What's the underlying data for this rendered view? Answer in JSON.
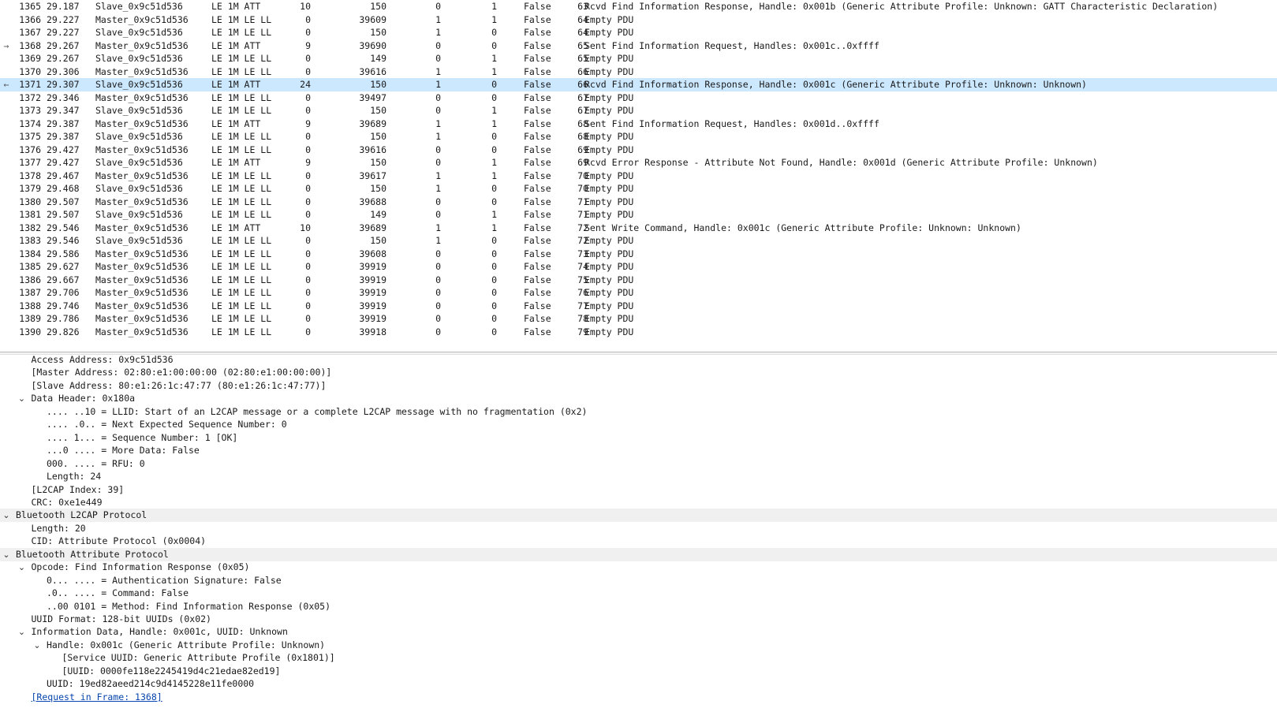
{
  "packets": [
    {
      "no": "1365",
      "time": "29.187",
      "src": "Slave_0x9c51d536",
      "proto": "LE 1M ATT",
      "len": "10",
      "ch": "150",
      "sn": "0",
      "nesn": "1",
      "md": "False",
      "idx": "63",
      "info": "Rcvd Find Information Response, Handle: 0x001b (Generic Attribute Profile: Unknown: GATT Characteristic Declaration)",
      "arrow": ""
    },
    {
      "no": "1366",
      "time": "29.227",
      "src": "Master_0x9c51d536",
      "proto": "LE 1M LE LL",
      "len": "0",
      "ch": "39609",
      "sn": "1",
      "nesn": "1",
      "md": "False",
      "idx": "64",
      "info": "Empty PDU",
      "arrow": ""
    },
    {
      "no": "1367",
      "time": "29.227",
      "src": "Slave_0x9c51d536",
      "proto": "LE 1M LE LL",
      "len": "0",
      "ch": "150",
      "sn": "1",
      "nesn": "0",
      "md": "False",
      "idx": "64",
      "info": "Empty PDU",
      "arrow": ""
    },
    {
      "no": "1368",
      "time": "29.267",
      "src": "Master_0x9c51d536",
      "proto": "LE 1M ATT",
      "len": "9",
      "ch": "39690",
      "sn": "0",
      "nesn": "0",
      "md": "False",
      "idx": "65",
      "info": "Sent Find Information Request, Handles: 0x001c..0xffff",
      "arrow": "→"
    },
    {
      "no": "1369",
      "time": "29.267",
      "src": "Slave_0x9c51d536",
      "proto": "LE 1M LE LL",
      "len": "0",
      "ch": "149",
      "sn": "0",
      "nesn": "1",
      "md": "False",
      "idx": "65",
      "info": "Empty PDU",
      "arrow": ""
    },
    {
      "no": "1370",
      "time": "29.306",
      "src": "Master_0x9c51d536",
      "proto": "LE 1M LE LL",
      "len": "0",
      "ch": "39616",
      "sn": "1",
      "nesn": "1",
      "md": "False",
      "idx": "66",
      "info": "Empty PDU",
      "arrow": ""
    },
    {
      "no": "1371",
      "time": "29.307",
      "src": "Slave_0x9c51d536",
      "proto": "LE 1M ATT",
      "len": "24",
      "ch": "150",
      "sn": "1",
      "nesn": "0",
      "md": "False",
      "idx": "66",
      "info": "Rcvd Find Information Response, Handle: 0x001c (Generic Attribute Profile: Unknown: Unknown)",
      "arrow": "←",
      "selected": true
    },
    {
      "no": "1372",
      "time": "29.346",
      "src": "Master_0x9c51d536",
      "proto": "LE 1M LE LL",
      "len": "0",
      "ch": "39497",
      "sn": "0",
      "nesn": "0",
      "md": "False",
      "idx": "67",
      "info": "Empty PDU",
      "arrow": ""
    },
    {
      "no": "1373",
      "time": "29.347",
      "src": "Slave_0x9c51d536",
      "proto": "LE 1M LE LL",
      "len": "0",
      "ch": "150",
      "sn": "0",
      "nesn": "1",
      "md": "False",
      "idx": "67",
      "info": "Empty PDU",
      "arrow": ""
    },
    {
      "no": "1374",
      "time": "29.387",
      "src": "Master_0x9c51d536",
      "proto": "LE 1M ATT",
      "len": "9",
      "ch": "39689",
      "sn": "1",
      "nesn": "1",
      "md": "False",
      "idx": "68",
      "info": "Sent Find Information Request, Handles: 0x001d..0xffff",
      "arrow": ""
    },
    {
      "no": "1375",
      "time": "29.387",
      "src": "Slave_0x9c51d536",
      "proto": "LE 1M LE LL",
      "len": "0",
      "ch": "150",
      "sn": "1",
      "nesn": "0",
      "md": "False",
      "idx": "68",
      "info": "Empty PDU",
      "arrow": ""
    },
    {
      "no": "1376",
      "time": "29.427",
      "src": "Master_0x9c51d536",
      "proto": "LE 1M LE LL",
      "len": "0",
      "ch": "39616",
      "sn": "0",
      "nesn": "0",
      "md": "False",
      "idx": "69",
      "info": "Empty PDU",
      "arrow": ""
    },
    {
      "no": "1377",
      "time": "29.427",
      "src": "Slave_0x9c51d536",
      "proto": "LE 1M ATT",
      "len": "9",
      "ch": "150",
      "sn": "0",
      "nesn": "1",
      "md": "False",
      "idx": "69",
      "info": "Rcvd Error Response - Attribute Not Found, Handle: 0x001d (Generic Attribute Profile: Unknown)",
      "arrow": ""
    },
    {
      "no": "1378",
      "time": "29.467",
      "src": "Master_0x9c51d536",
      "proto": "LE 1M LE LL",
      "len": "0",
      "ch": "39617",
      "sn": "1",
      "nesn": "1",
      "md": "False",
      "idx": "70",
      "info": "Empty PDU",
      "arrow": ""
    },
    {
      "no": "1379",
      "time": "29.468",
      "src": "Slave_0x9c51d536",
      "proto": "LE 1M LE LL",
      "len": "0",
      "ch": "150",
      "sn": "1",
      "nesn": "0",
      "md": "False",
      "idx": "70",
      "info": "Empty PDU",
      "arrow": ""
    },
    {
      "no": "1380",
      "time": "29.507",
      "src": "Master_0x9c51d536",
      "proto": "LE 1M LE LL",
      "len": "0",
      "ch": "39688",
      "sn": "0",
      "nesn": "0",
      "md": "False",
      "idx": "71",
      "info": "Empty PDU",
      "arrow": ""
    },
    {
      "no": "1381",
      "time": "29.507",
      "src": "Slave_0x9c51d536",
      "proto": "LE 1M LE LL",
      "len": "0",
      "ch": "149",
      "sn": "0",
      "nesn": "1",
      "md": "False",
      "idx": "71",
      "info": "Empty PDU",
      "arrow": ""
    },
    {
      "no": "1382",
      "time": "29.546",
      "src": "Master_0x9c51d536",
      "proto": "LE 1M ATT",
      "len": "10",
      "ch": "39689",
      "sn": "1",
      "nesn": "1",
      "md": "False",
      "idx": "72",
      "info": "Sent Write Command, Handle: 0x001c (Generic Attribute Profile: Unknown: Unknown)",
      "arrow": ""
    },
    {
      "no": "1383",
      "time": "29.546",
      "src": "Slave_0x9c51d536",
      "proto": "LE 1M LE LL",
      "len": "0",
      "ch": "150",
      "sn": "1",
      "nesn": "0",
      "md": "False",
      "idx": "72",
      "info": "Empty PDU",
      "arrow": ""
    },
    {
      "no": "1384",
      "time": "29.586",
      "src": "Master_0x9c51d536",
      "proto": "LE 1M LE LL",
      "len": "0",
      "ch": "39608",
      "sn": "0",
      "nesn": "0",
      "md": "False",
      "idx": "73",
      "info": "Empty PDU",
      "arrow": ""
    },
    {
      "no": "1385",
      "time": "29.627",
      "src": "Master_0x9c51d536",
      "proto": "LE 1M LE LL",
      "len": "0",
      "ch": "39919",
      "sn": "0",
      "nesn": "0",
      "md": "False",
      "idx": "74",
      "info": "Empty PDU",
      "arrow": ""
    },
    {
      "no": "1386",
      "time": "29.667",
      "src": "Master_0x9c51d536",
      "proto": "LE 1M LE LL",
      "len": "0",
      "ch": "39919",
      "sn": "0",
      "nesn": "0",
      "md": "False",
      "idx": "75",
      "info": "Empty PDU",
      "arrow": ""
    },
    {
      "no": "1387",
      "time": "29.706",
      "src": "Master_0x9c51d536",
      "proto": "LE 1M LE LL",
      "len": "0",
      "ch": "39919",
      "sn": "0",
      "nesn": "0",
      "md": "False",
      "idx": "76",
      "info": "Empty PDU",
      "arrow": ""
    },
    {
      "no": "1388",
      "time": "29.746",
      "src": "Master_0x9c51d536",
      "proto": "LE 1M LE LL",
      "len": "0",
      "ch": "39919",
      "sn": "0",
      "nesn": "0",
      "md": "False",
      "idx": "77",
      "info": "Empty PDU",
      "arrow": ""
    },
    {
      "no": "1389",
      "time": "29.786",
      "src": "Master_0x9c51d536",
      "proto": "LE 1M LE LL",
      "len": "0",
      "ch": "39919",
      "sn": "0",
      "nesn": "0",
      "md": "False",
      "idx": "78",
      "info": "Empty PDU",
      "arrow": ""
    },
    {
      "no": "1390",
      "time": "29.826",
      "src": "Master_0x9c51d536",
      "proto": "LE 1M LE LL",
      "len": "0",
      "ch": "39918",
      "sn": "0",
      "nesn": "0",
      "md": "False",
      "idx": "79",
      "info": "Empty PDU",
      "arrow": ""
    }
  ],
  "details": [
    {
      "text": "Access Address: 0x9c51d536",
      "level": 2,
      "expander": "none"
    },
    {
      "text": "[Master Address: 02:80:e1:00:00:00 (02:80:e1:00:00:00)]",
      "level": 2,
      "expander": "none"
    },
    {
      "text": "[Slave Address: 80:e1:26:1c:47:77 (80:e1:26:1c:47:77)]",
      "level": 2,
      "expander": "none"
    },
    {
      "text": "Data Header: 0x180a",
      "level": 2,
      "expander": "expanded"
    },
    {
      "text": ".... ..10 = LLID: Start of an L2CAP message or a complete L2CAP message with no fragmentation (0x2)",
      "level": 3,
      "expander": "none"
    },
    {
      "text": ".... .0.. = Next Expected Sequence Number: 0",
      "level": 3,
      "expander": "none"
    },
    {
      "text": ".... 1... = Sequence Number: 1 [OK]",
      "level": 3,
      "expander": "none"
    },
    {
      "text": "...0 .... = More Data: False",
      "level": 3,
      "expander": "none"
    },
    {
      "text": "000. .... = RFU: 0",
      "level": 3,
      "expander": "none"
    },
    {
      "text": "Length: 24",
      "level": 3,
      "expander": "none"
    },
    {
      "text": "[L2CAP Index: 39]",
      "level": 2,
      "expander": "none"
    },
    {
      "text": "CRC: 0xe1e449",
      "level": 2,
      "expander": "none"
    },
    {
      "text": "Bluetooth L2CAP Protocol",
      "level": 1,
      "expander": "expanded",
      "section": true
    },
    {
      "text": "Length: 20",
      "level": 2,
      "expander": "none"
    },
    {
      "text": "CID: Attribute Protocol (0x0004)",
      "level": 2,
      "expander": "none"
    },
    {
      "text": "Bluetooth Attribute Protocol",
      "level": 1,
      "expander": "expanded",
      "section": true
    },
    {
      "text": "Opcode: Find Information Response (0x05)",
      "level": 2,
      "expander": "expanded"
    },
    {
      "text": "0... .... = Authentication Signature: False",
      "level": 3,
      "expander": "none"
    },
    {
      "text": ".0.. .... = Command: False",
      "level": 3,
      "expander": "none"
    },
    {
      "text": "..00 0101 = Method: Find Information Response (0x05)",
      "level": 3,
      "expander": "none"
    },
    {
      "text": "UUID Format: 128-bit UUIDs (0x02)",
      "level": 2,
      "expander": "none"
    },
    {
      "text": "Information Data, Handle: 0x001c, UUID: Unknown",
      "level": 2,
      "expander": "expanded"
    },
    {
      "text": "Handle: 0x001c (Generic Attribute Profile: Unknown)",
      "level": 3,
      "expander": "expanded"
    },
    {
      "text": "[Service UUID: Generic Attribute Profile (0x1801)]",
      "level": 4,
      "expander": "none"
    },
    {
      "text": "[UUID: 0000fe118e2245419d4c21edae82ed19]",
      "level": 4,
      "expander": "none"
    },
    {
      "text": "UUID: 19ed82aeed214c9d4145228e11fe0000",
      "level": 3,
      "expander": "none"
    },
    {
      "text": "[Request in Frame: 1368]",
      "level": 2,
      "expander": "none",
      "link": true
    }
  ],
  "icons": {
    "expanded": "chevron-down-icon",
    "collapsed": "chevron-right-icon"
  }
}
